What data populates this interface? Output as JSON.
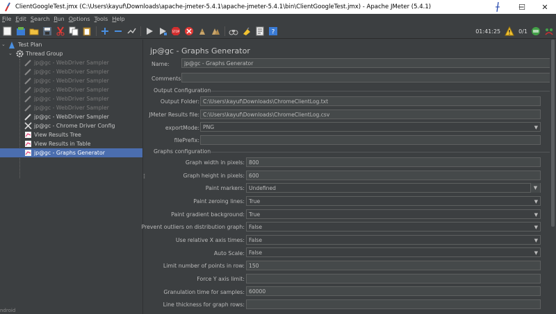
{
  "window": {
    "title": "ClientGoogleTest.jmx (C:\\Users\\kayuf\\Downloads\\apache-jmeter-5.4.1\\apache-jmeter-5.4.1\\bin\\ClientGoogleTest.jmx) - Apache JMeter (5.4.1)",
    "minimize": "─",
    "maximize": "☐",
    "close": "✕"
  },
  "menu": {
    "file": "File",
    "edit": "Edit",
    "search": "Search",
    "run": "Run",
    "options": "Options",
    "tools": "Tools",
    "help": "Help"
  },
  "toolbar": {
    "timer": "01:41:25",
    "threads": "0/1"
  },
  "tree": {
    "test_plan": "Test Plan",
    "thread_group": "Thread Group",
    "items": [
      {
        "label": "jp@gc - WebDriver Sampler"
      },
      {
        "label": "jp@gc - WebDriver Sampler"
      },
      {
        "label": "jp@gc - WebDriver Sampler"
      },
      {
        "label": "jp@gc - WebDriver Sampler"
      },
      {
        "label": "jp@gc - WebDriver Sampler"
      },
      {
        "label": "jp@gc - WebDriver Sampler"
      },
      {
        "label": "jp@gc - WebDriver Sampler"
      },
      {
        "label": "jp@gc - Chrome Driver Config"
      },
      {
        "label": "View Results Tree"
      },
      {
        "label": "View Results in Table"
      },
      {
        "label": "jp@gc - Graphs Generator"
      }
    ],
    "bottom_text": "ndroid"
  },
  "panel": {
    "title": "jp@gc - Graphs Generator",
    "name_label": "Name:",
    "name_value": "jp@gc - Graphs Generator",
    "comments_label": "Comments:",
    "comments_value": "",
    "output_section": "Output Configuration",
    "output_folder_label": "Output Folder:",
    "output_folder_value": "C:\\Users\\kayuf\\Downloads\\ChromeClientLog.txt",
    "results_file_label": "JMeter Results file:",
    "results_file_value": "C:\\Users\\kayuf\\Downloads\\ChromeClientLog.csv",
    "export_mode_label": "exportMode:",
    "export_mode_value": "PNG",
    "file_prefix_label": "filePrefix:",
    "file_prefix_value": "",
    "graphs_section": "Graphs configuration",
    "fields": {
      "width_label": "Graph width in pixels:",
      "width_value": "800",
      "height_label": "Graph height in pixels:",
      "height_value": "600",
      "paint_markers_label": "Paint markers:",
      "paint_markers_value": "Undefined",
      "zeroing_label": "Paint zeroing lines:",
      "zeroing_value": "True",
      "gradient_label": "Paint gradient background:",
      "gradient_value": "True",
      "outliers_label": "Prevent outliers on distribution graph:",
      "outliers_value": "False",
      "relative_x_label": "Use relative X axis times:",
      "relative_x_value": "False",
      "autoscale_label": "Auto Scale:",
      "autoscale_value": "False",
      "limit_points_label": "Limit number of points in row:",
      "limit_points_value": "150",
      "force_y_label": "Force Y axis limit:",
      "force_y_value": "",
      "granulation_label": "Granulation time for samples:",
      "granulation_value": "60000",
      "line_thickness_label": "Line thickness for graph rows:",
      "line_thickness_value": ""
    }
  }
}
